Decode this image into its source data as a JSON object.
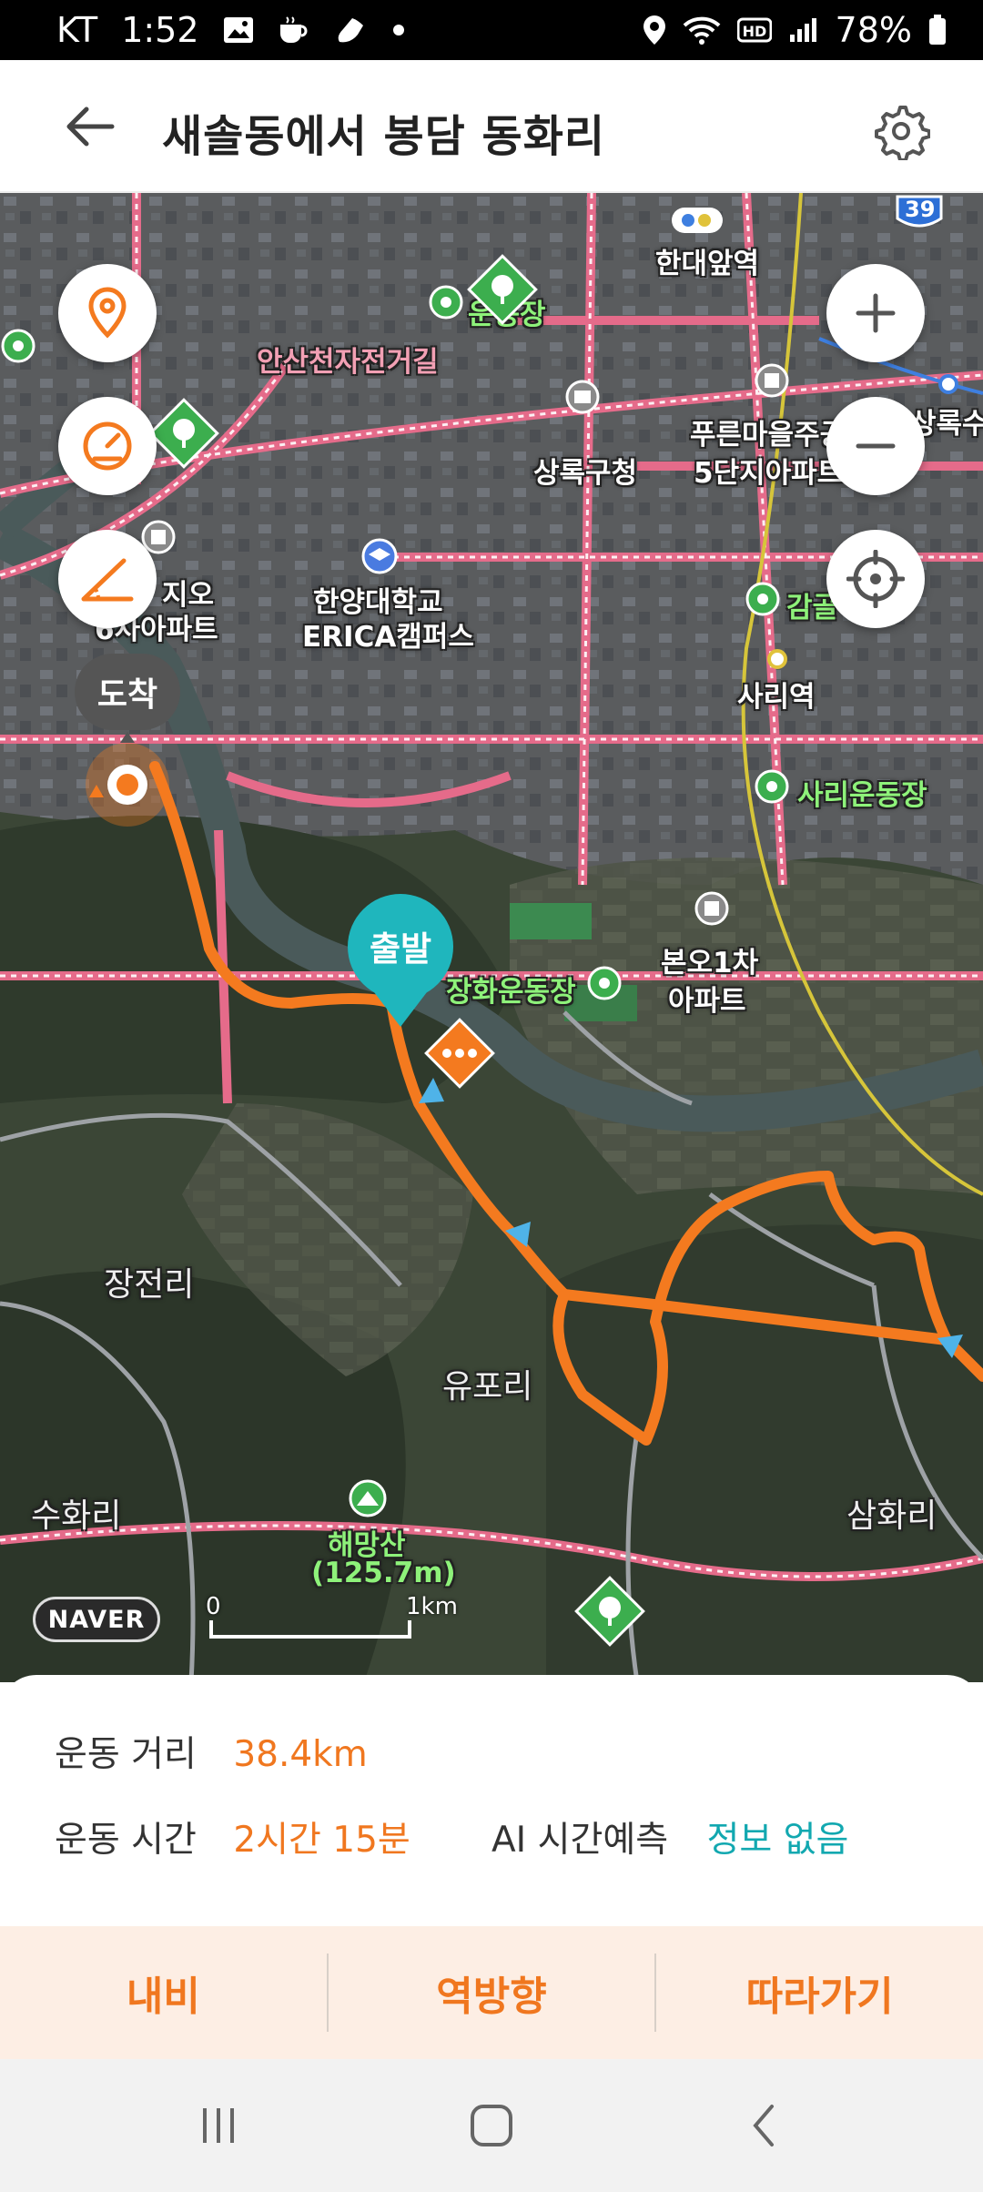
{
  "status_bar": {
    "carrier": "KT",
    "time": "1:52",
    "battery": "78%",
    "icons": [
      "image-icon",
      "coffee-icon",
      "shoe-icon",
      "dot-icon",
      "location-icon",
      "wifi-icon",
      "hd-icon",
      "signal-icon",
      "battery-icon"
    ]
  },
  "header": {
    "title": "새솔동에서 봉담 동화리",
    "back_icon": "arrow-left-icon",
    "settings_icon": "gear-icon"
  },
  "map": {
    "labels": {
      "handaeap": "한대앞역",
      "ansan_bike": "안산천자전거길",
      "sangnok_gu": "상록구청",
      "pureun": "푸른마을주공",
      "pureun2": "5단지아파트",
      "sangnoksu": "상록수",
      "jio": "지오",
      "jio2": "6차아파트",
      "hanyang": "한양대학교",
      "hanyang2": "ERICA캠퍼스",
      "gamgol": "감골",
      "sari_station": "사리역",
      "sari_field": "사리운동장",
      "janghwa_field": "장화운동장",
      "bono": "본오1차",
      "bono2": "아파트",
      "jangjeon": "장전리",
      "yupo": "유포리",
      "suhwa": "수화리",
      "samhwa": "삼화리",
      "haemang": "해망산",
      "haemang_h": "(125.7m)",
      "park_top": "운동장",
      "route39": "39"
    },
    "arrival_label": "도착",
    "departure_label": "출발",
    "naver_logo": "NAVER",
    "scale_start": "0",
    "scale_end": "1km"
  },
  "stats": {
    "distance_label": "운동 거리",
    "distance_value": "38.4km",
    "time_label": "운동 시간",
    "time_value": "2시간 15분",
    "ai_label": "AI 시간예측",
    "ai_value": "정보 없음"
  },
  "actions": {
    "navi": "내비",
    "reverse": "역방향",
    "follow": "따라가기"
  },
  "colors": {
    "accent": "#f0771f",
    "teal": "#12a8b0",
    "route": "#f47a1f",
    "action_bg": "#fdeee4"
  }
}
